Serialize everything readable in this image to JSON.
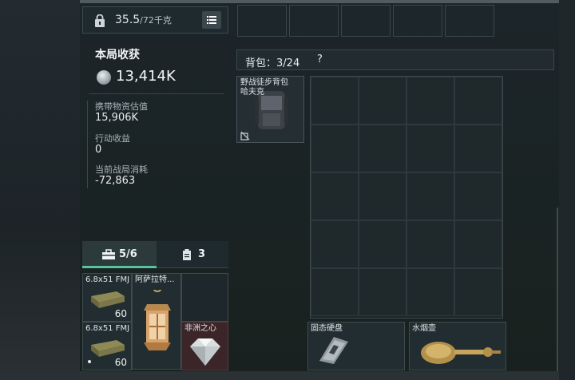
{
  "weight": {
    "current": "35.5",
    "limit": "/72千克"
  },
  "summary": {
    "title": "本局收获",
    "total_value": "13,414K",
    "carried_label": "携带物资估值",
    "carried_value": "15,906K",
    "action_label": "行动收益",
    "action_value": "0",
    "cost_label": "当前战局消耗",
    "cost_value": "-72,863"
  },
  "tabs": [
    {
      "label": "5/6",
      "icon": "toolbox-icon",
      "active": true
    },
    {
      "label": "3",
      "icon": "clipboard-icon",
      "active": false
    }
  ],
  "pouch_items": [
    {
      "name": "6.8x51 FMJ",
      "count": "60",
      "icon": "ammo-box-icon"
    },
    {
      "name": "阿萨拉特...",
      "icon": "lantern-icon"
    },
    {
      "name": "6.8x51 FMJ",
      "count": "60",
      "icon": "ammo-box-icon"
    },
    {
      "name": "非洲之心",
      "icon": "diamond-icon"
    }
  ],
  "backpack": {
    "title": "背包",
    "capacity": "3/24",
    "help": "?",
    "equipped_name_line1": "野战徒步背包",
    "equipped_name_line2": "哈夫克",
    "items": [
      {
        "name": "固态硬盘",
        "icon": "ssd-icon"
      },
      {
        "name": "水烟壶",
        "icon": "hookah-icon"
      }
    ]
  },
  "colors": {
    "accent": "#59c3a0",
    "rare": "#3b2528"
  }
}
